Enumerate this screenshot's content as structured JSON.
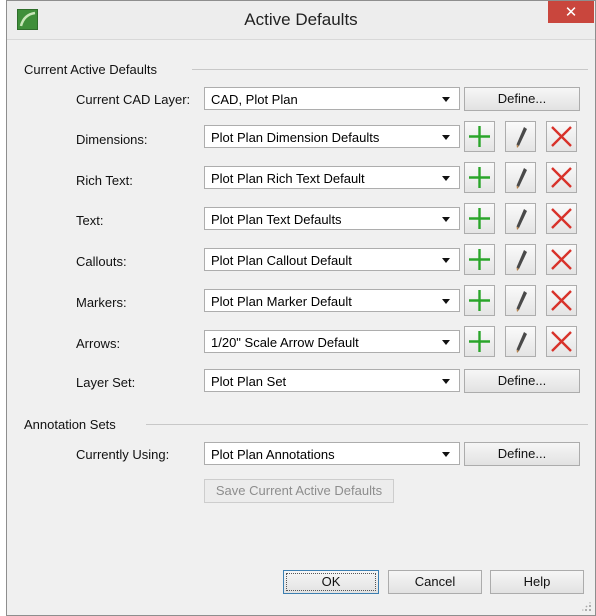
{
  "window": {
    "title": "Active Defaults",
    "close_glyph": "✕",
    "app_icon": "app-logo-icon",
    "accent_close": "#c9463d"
  },
  "current": {
    "group_label": "Current Active Defaults",
    "cad_layer": {
      "label": "Current CAD Layer:",
      "value": "CAD, Plot Plan",
      "define": "Define..."
    },
    "rows": [
      {
        "label": "Dimensions:",
        "value": "Plot Plan Dimension Defaults"
      },
      {
        "label": "Rich Text:",
        "value": "Plot Plan Rich Text Default"
      },
      {
        "label": "Text:",
        "value": "Plot Plan Text Defaults"
      },
      {
        "label": "Callouts:",
        "value": "Plot Plan Callout Default"
      },
      {
        "label": "Markers:",
        "value": "Plot Plan Marker Default"
      },
      {
        "label": "Arrows:",
        "value": "1/20\" Scale Arrow Default"
      }
    ],
    "layer_set": {
      "label": "Layer Set:",
      "value": "Plot Plan Set",
      "define": "Define..."
    },
    "row_icons": {
      "add": "plus-icon",
      "edit": "pencil-icon",
      "delete": "x-icon"
    }
  },
  "annotation": {
    "group_label": "Annotation Sets",
    "currently_using": {
      "label": "Currently Using:",
      "value": "Plot Plan Annotations",
      "define": "Define..."
    },
    "save_button": "Save Current Active Defaults"
  },
  "footer": {
    "ok": "OK",
    "cancel": "Cancel",
    "help": "Help"
  },
  "colors": {
    "plus": "#2aa52a",
    "delete": "#d8322a",
    "pencil": "#4a4a4a"
  }
}
